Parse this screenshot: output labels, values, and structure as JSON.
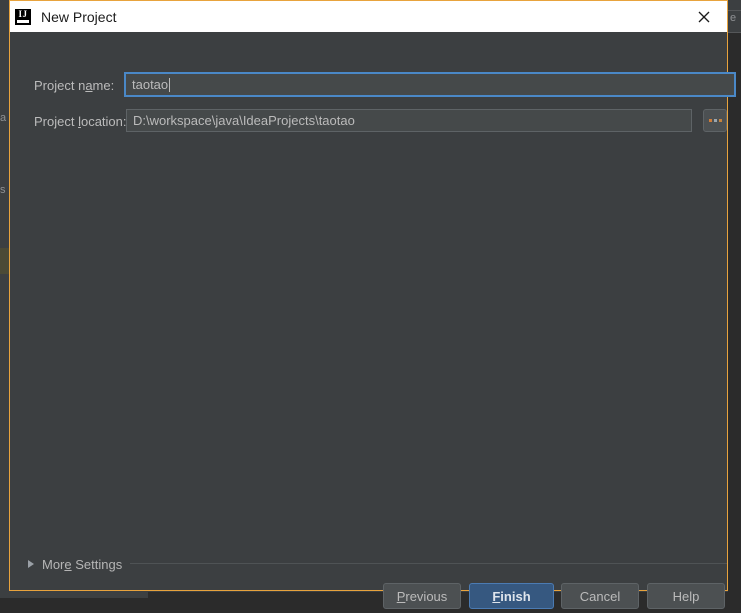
{
  "background": {
    "left_strip_texts": [
      "a",
      "s"
    ],
    "right_tab_text": "e"
  },
  "dialog": {
    "title": "New Project",
    "icon": "intellij-idea-logo",
    "close_icon": "close-icon",
    "accent_border_color": "#e8a33d",
    "background_color": "#3c3f41",
    "fields": [
      {
        "name": "project-name",
        "label_before": "Project n",
        "label_mnemonic": "a",
        "label_after": "me:",
        "label_full": "Project name:",
        "value": "taotao",
        "focused": true
      },
      {
        "name": "project-location",
        "label_before": "Project ",
        "label_mnemonic": "l",
        "label_after": "ocation:",
        "label_full": "Project location:",
        "value": "D:\\workspace\\java\\IdeaProjects\\taotao",
        "focused": false
      }
    ],
    "browse_button": {
      "label": "...",
      "icon": "ellipsis-icon"
    },
    "more_settings": {
      "label_before": "Mor",
      "label_mnemonic": "e",
      "label_after": " Settings",
      "label_full": "More Settings",
      "expanded": false,
      "arrow_icon": "chevron-right-icon"
    },
    "buttons": [
      {
        "name": "previous",
        "label_before": "",
        "label_mnemonic": "P",
        "label_after": "revious",
        "label_full": "Previous",
        "default": false
      },
      {
        "name": "finish",
        "label_before": "",
        "label_mnemonic": "F",
        "label_after": "inish",
        "label_full": "Finish",
        "default": true,
        "accent_color": "#365880"
      },
      {
        "name": "cancel",
        "label_before": "",
        "label_mnemonic": "",
        "label_after": "Cancel",
        "label_full": "Cancel",
        "default": false
      },
      {
        "name": "help",
        "label_before": "",
        "label_mnemonic": "",
        "label_after": "Help",
        "label_full": "Help",
        "default": false
      }
    ]
  }
}
